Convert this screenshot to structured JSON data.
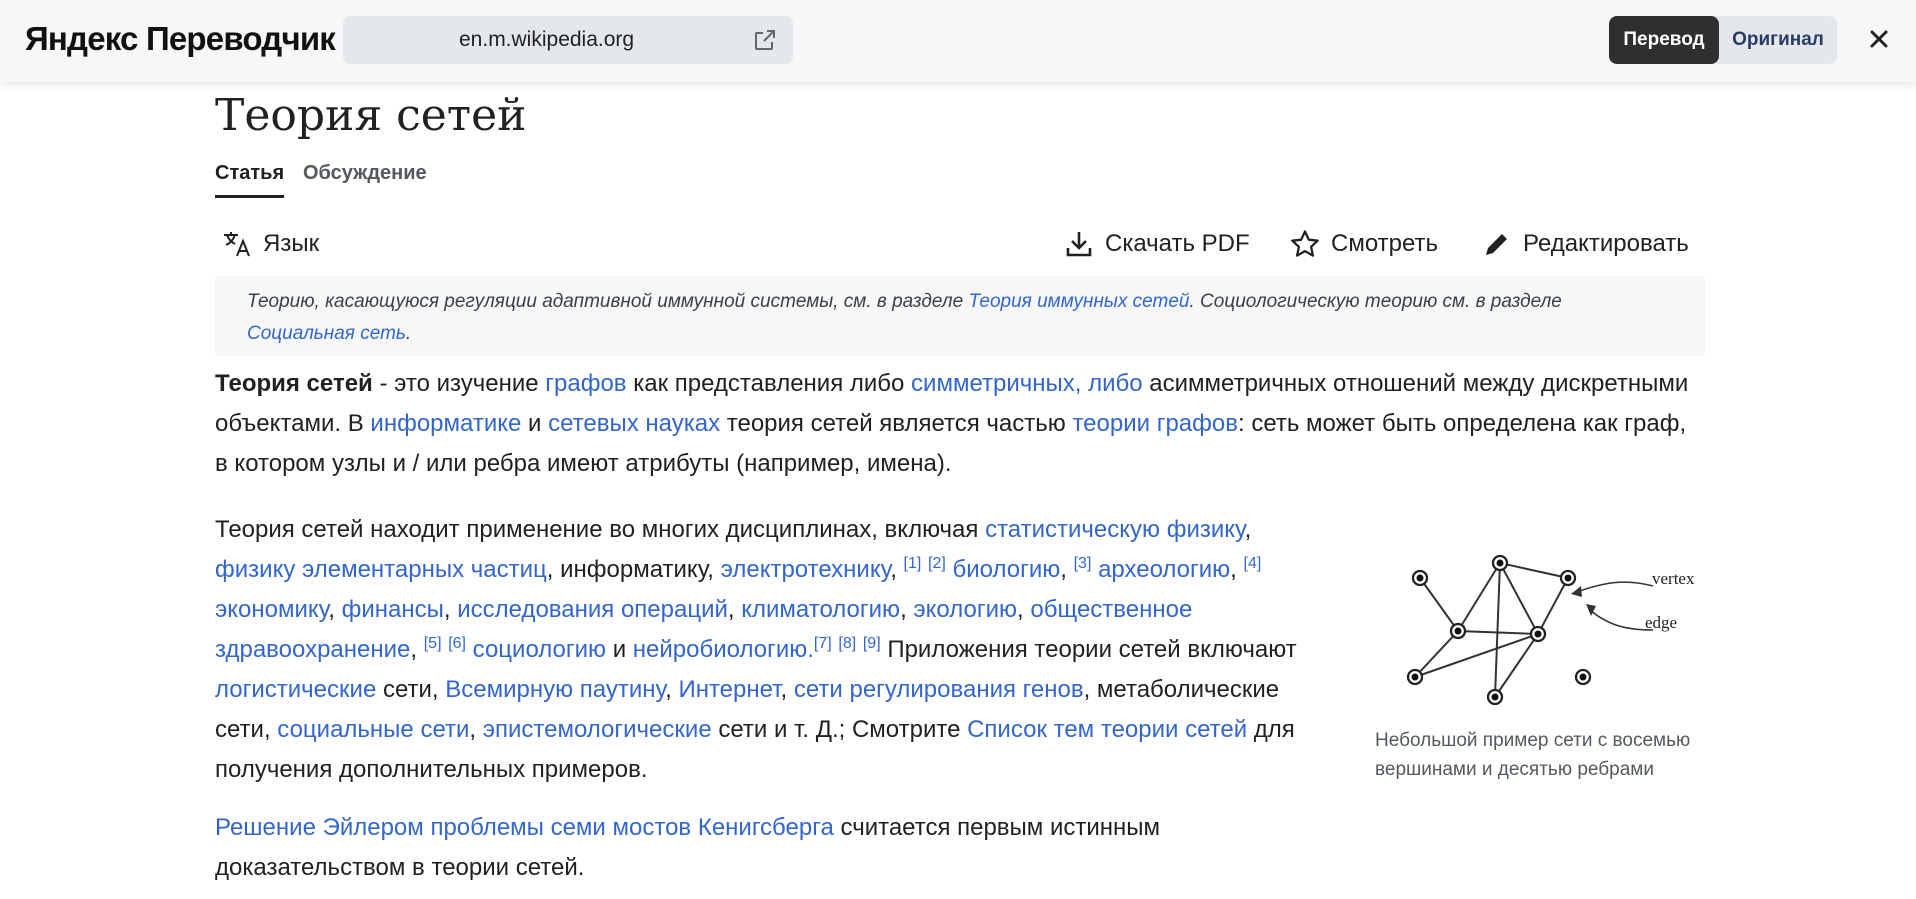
{
  "topbar": {
    "brand": "Яндекс Переводчик",
    "url": "en.m.wikipedia.org",
    "translate_label": "Перевод",
    "original_label": "Оригинал"
  },
  "page": {
    "title": "Теория сетей",
    "tabs": [
      {
        "label": "Статья"
      },
      {
        "label": "Обсуждение"
      }
    ],
    "actions": {
      "language": "Язык",
      "download_pdf": "Скачать PDF",
      "watch": "Смотреть",
      "edit": "Редактировать"
    }
  },
  "hatnote": {
    "t1": "Теорию, касающуюся регуляции адаптивной иммунной системы, см. в разделе ",
    "l1": "Теория иммунных сетей",
    "t2": ". Социологическую теорию см. в разделе ",
    "l2": "Социальная сеть",
    "t3": "."
  },
  "p1": {
    "b1": "Теория сетей",
    "t1": " - это изучение ",
    "l1": "графов",
    "t2": " как представления либо ",
    "l2": "симметричных, либо",
    "t3": " асимметричных отношений между дискретными объектами. В ",
    "l3": "информатике",
    "t4": " и ",
    "l4": "сетевых науках",
    "t5": " теория сетей является частью ",
    "l5": "теории графов",
    "t6": ": сеть может быть определена как граф, в котором узлы и / или ребра имеют атрибуты (например, имена)."
  },
  "p2": {
    "t1": "Теория сетей находит применение во многих дисциплинах, включая ",
    "l1": "статистическую физику",
    "t2": ", ",
    "l2": "физику элементарных частиц",
    "t3": ", информатику, ",
    "l3": "электротехнику",
    "t4": ", ",
    "r1": "[1]",
    "r2": "[2]",
    "l4": "биологию",
    "t5": ", ",
    "r3": "[3]",
    "l5": "археологию",
    "t6": ", ",
    "r4": "[4]",
    "l6": "экономику",
    "t7": ", ",
    "l7": "финансы",
    "t8": ", ",
    "l8": "исследования операций",
    "t9": ", ",
    "l9": "климатологию",
    "t10": ", ",
    "l10": "экологию",
    "t11": ", ",
    "l11": "общественное здравоохранение",
    "t12": ", ",
    "r5": "[5]",
    "r6": "[6]",
    "l12": "социологию",
    "t13": " и ",
    "l13": "нейробиологию.",
    "r7": "[7]",
    "r8": "[8]",
    "r9": "[9]",
    "t14": " Приложения теории сетей включают ",
    "l14": "логистические",
    "t15": " сети, ",
    "l15": "Всемирную паутину",
    "t16": ", ",
    "l16": "Интернет",
    "t17": ", ",
    "l17": "сети регулирования генов",
    "t18": ", метаболические сети, ",
    "l18": "социальные сети",
    "t19": ", ",
    "l19": "эпистемологические",
    "t20": " сети и т. Д.; Смотрите ",
    "l20": "Список тем теории сетей",
    "t21": " для получения дополнительных примеров."
  },
  "p3": {
    "l1": "Решение Эйлером проблемы семи мостов Кенигсберга",
    "t1": " считается первым истинным доказательством в теории сетей."
  },
  "figure": {
    "vertex_label": "vertex",
    "edge_label": "edge",
    "caption": "Небольшой пример сети с восемью вершинами и десятью ребрами"
  },
  "colors": {
    "link": "#3366cc",
    "text": "#202122",
    "topbar_bg": "#f6f7f9",
    "active_toggle": "#2f2f2f"
  },
  "icons": [
    "external-link-icon",
    "close-icon",
    "translate-icon",
    "download-icon",
    "star-icon",
    "pencil-icon"
  ]
}
